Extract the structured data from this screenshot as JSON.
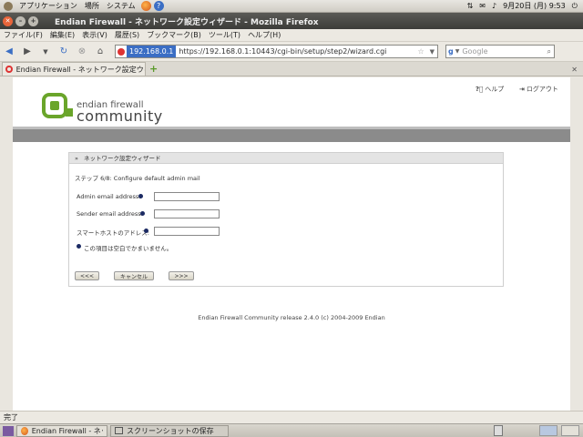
{
  "panel": {
    "menus": [
      "アプリケーション",
      "場所",
      "システム"
    ],
    "datetime": "9月20日 (月)  9:53"
  },
  "window": {
    "title": "Endian Firewall - ネットワーク設定ウィザード - Mozilla Firefox"
  },
  "menubar": [
    "ファイル(F)",
    "編集(E)",
    "表示(V)",
    "履歴(S)",
    "ブックマーク(B)",
    "ツール(T)",
    "ヘルプ(H)"
  ],
  "nav": {
    "url_host": "192.168.0.1",
    "url": "https://192.168.0.1:10443/cgi-bin/setup/step2/wizard.cgi",
    "search_placeholder": "Google"
  },
  "tabs": [
    {
      "label": "Endian Firewall - ネットワーク設定ウィ..."
    }
  ],
  "page": {
    "logo_top": "endian firewall",
    "logo_bottom": "community",
    "help_link": "ヘルプ",
    "logout_link": "ログアウト",
    "wizard": {
      "header": "ネットワーク設定ウィザード",
      "step": "ステップ 6/8: Configure default admin mail",
      "fields": [
        {
          "label": "Admin email address:",
          "value": ""
        },
        {
          "label": "Sender email address:",
          "value": ""
        },
        {
          "label": "スマートホストのアドレス:",
          "value": ""
        }
      ],
      "note": "この項目は空白でかまいません。",
      "buttons": {
        "back": "<<<",
        "cancel": "キャンセル",
        "next": ">>>"
      }
    },
    "footer": "Endian Firewall Community release 2.4.0 (c) 2004-2009 Endian"
  },
  "status": "完了",
  "taskbar": {
    "items": [
      "Endian Firewall - ネッ...",
      "スクリーンショットの保存"
    ]
  },
  "colors": {
    "accent": "#6aa52a",
    "header_strip": "#8b8b8b",
    "dot": "#1b2a63"
  }
}
